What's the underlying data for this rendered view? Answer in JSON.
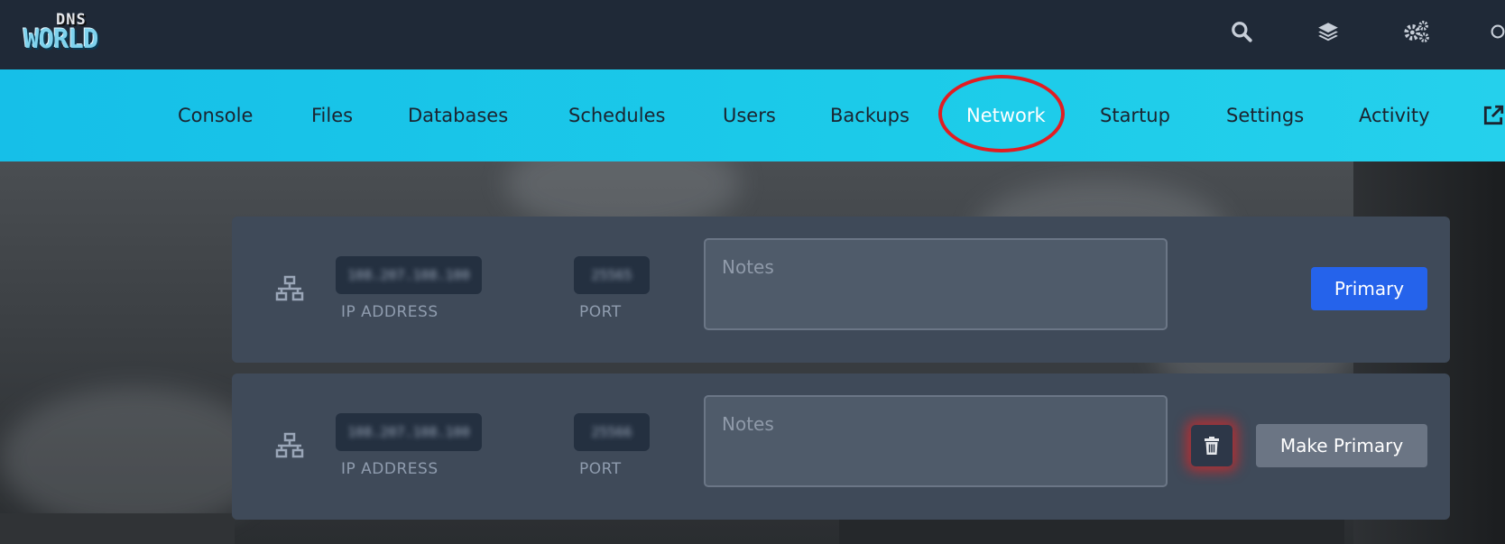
{
  "logo": {
    "line1": "DNS",
    "line2": "WORLD"
  },
  "topbar": {
    "icons": [
      "search-icon",
      "layers-icon",
      "cogs-icon",
      "account-icon"
    ]
  },
  "nav": {
    "items": [
      {
        "label": "Console"
      },
      {
        "label": "Files"
      },
      {
        "label": "Databases"
      },
      {
        "label": "Schedules"
      },
      {
        "label": "Users"
      },
      {
        "label": "Backups"
      },
      {
        "label": "Network",
        "active": true
      },
      {
        "label": "Startup"
      },
      {
        "label": "Settings"
      },
      {
        "label": "Activity"
      }
    ],
    "external_icon": "external-link-icon",
    "highlight_color": "#e11d22"
  },
  "allocations": [
    {
      "ip": "108.207.108.100",
      "ip_label": "IP ADDRESS",
      "port": "25565",
      "port_label": "PORT",
      "notes_placeholder": "Notes",
      "button_label": "Primary"
    },
    {
      "ip": "108.207.108.100",
      "ip_label": "IP ADDRESS",
      "port": "25566",
      "port_label": "PORT",
      "notes_placeholder": "Notes",
      "button_label": "Make Primary",
      "delete_icon": "trash-icon"
    }
  ],
  "colors": {
    "topbar": "#1f2937",
    "nav": "#1cc8ea",
    "card": "#3f4a59",
    "primary": "#2563eb",
    "secondary": "#6b7584"
  }
}
